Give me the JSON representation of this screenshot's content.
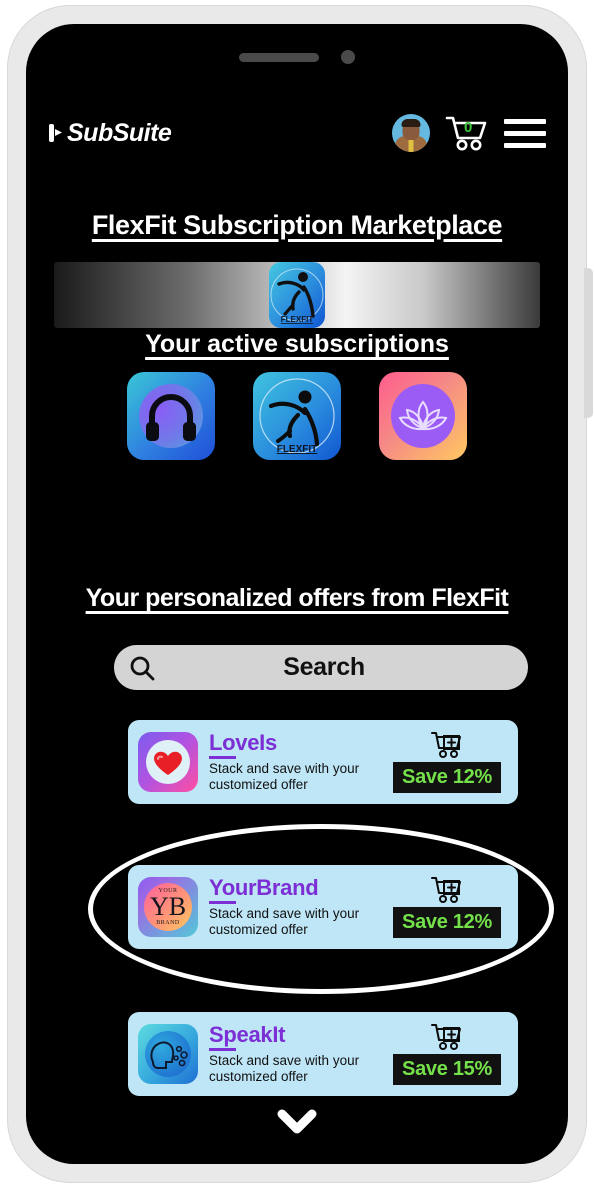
{
  "app": {
    "brand": "SubSuite",
    "brand_mark_icon": "subsuite-logo-icon"
  },
  "header": {
    "avatar_icon": "user-avatar",
    "cart_icon": "shopping-cart-icon",
    "cart_count": "0",
    "menu_icon": "hamburger-menu-icon"
  },
  "titles": {
    "page_title": "FlexFit Subscription Marketplace",
    "active_subscriptions": "Your active subscriptions",
    "personalized_offers": "Your personalized offers from FlexFit"
  },
  "hero": {
    "logo_icon": "flexfit-runner-icon",
    "logo_label": "FlexFit"
  },
  "active_subscriptions": [
    {
      "name": "Headphones audio subscription",
      "icon": "headphones-icon"
    },
    {
      "name": "FlexFit",
      "icon": "flexfit-runner-icon",
      "label": "FlexFit"
    },
    {
      "name": "Lotus wellness subscription",
      "icon": "lotus-icon"
    }
  ],
  "search": {
    "label": "Search",
    "placeholder": "Search",
    "icon": "search-icon"
  },
  "offers": [
    {
      "name": "LoveIs",
      "description": "Stack and save with your customized offer",
      "save_label": "Save 12%",
      "icon": "heart-icon",
      "cart_icon": "add-to-cart-icon"
    },
    {
      "name": "YourBrand",
      "description": "Stack and save with your customized offer",
      "save_label": "Save 12%",
      "icon": "yourbrand-monogram-icon",
      "icon_text_top": "YOUR",
      "icon_text_bottom": "BRAND",
      "icon_monogram": "YB",
      "cart_icon": "add-to-cart-icon",
      "highlighted": true
    },
    {
      "name": "SpeakIt",
      "description": "Stack and save with your customized offer",
      "save_label": "Save 15%",
      "icon": "speaking-head-icon",
      "cart_icon": "add-to-cart-icon"
    }
  ],
  "footer": {
    "scroll_icon": "chevron-down-icon"
  },
  "colors": {
    "screen_background": "#000000",
    "card_background": "#bfe6f7",
    "brand_purple": "#7b2fd4",
    "save_green": "#74e04a",
    "badge_background": "#111111",
    "cart_badge_green": "#3ec93e",
    "search_background": "#d4d4d4",
    "highlight": "#ffffff"
  }
}
